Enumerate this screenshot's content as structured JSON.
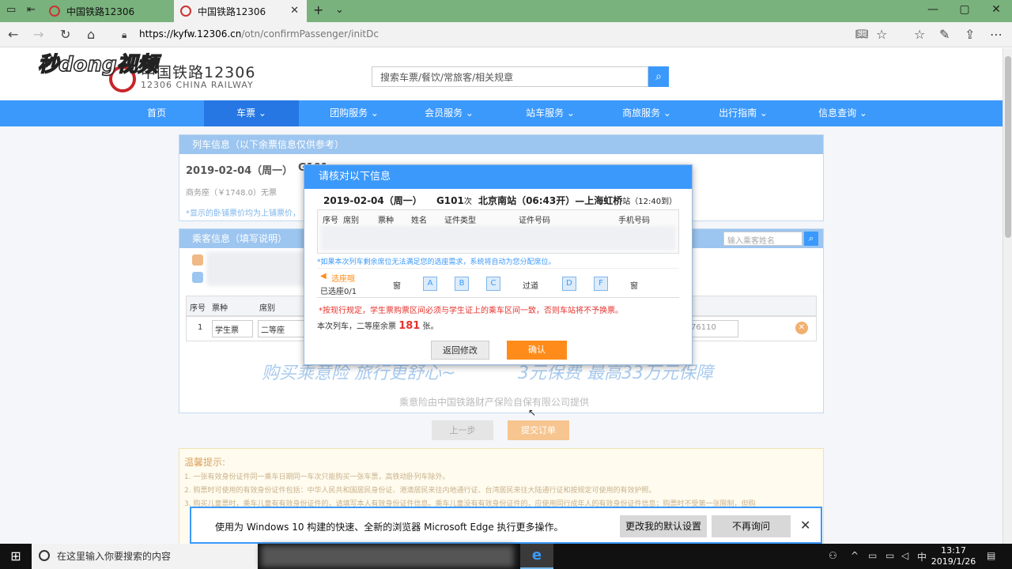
{
  "browser": {
    "tabs": [
      {
        "label": "中国铁路12306"
      },
      {
        "label": "中国铁路12306"
      }
    ],
    "url_host": "https://kyfw.12306.cn",
    "url_path": "/otn/confirmPassenger/initDc",
    "watermark": "秒dong视频"
  },
  "site": {
    "logo_cn": "中国铁路12306",
    "logo_en": "12306 CHINA RAILWAY",
    "search_placeholder": "搜索车票/餐饮/常旅客/相关规章",
    "nav": [
      "首页",
      "车票 ⌄",
      "团购服务 ⌄",
      "会员服务 ⌄",
      "站车服务 ⌄",
      "商旅服务 ⌄",
      "出行指南 ⌄",
      "信息查询 ⌄"
    ]
  },
  "train_panel": {
    "title": "列车信息（以下余票信息仅供参考）",
    "date": "2019-02-04（周一）",
    "train_no": "G101",
    "seat_price": "商务座（￥1748.0）无票",
    "note": "*显示的卧铺票价均为上铺票价，"
  },
  "passenger_panel": {
    "title": "乘客信息（填写说明）",
    "search_placeholder": "输入乘客姓名",
    "headers": [
      "序号",
      "票种",
      "席别"
    ],
    "row": {
      "index": "1",
      "ticket_type": "学生票",
      "seat": "二等座（￥5",
      "phone_tail": "76110"
    }
  },
  "insurance": {
    "slogan_prefix": "购买乘意险  旅行更舒心~",
    "slogan_price": "3元保费  最高33万元保障",
    "provider": "乘意险由中国铁路财产保险自保有限公司提供"
  },
  "page_actions": {
    "prev": "上一步",
    "submit": "提交订单"
  },
  "tips": {
    "title": "温馨提示:",
    "items": [
      "1. 一张有效身份证件同一乘车日期同一车次只能购买一张车票，高铁动卧列车除外。",
      "2. 购票时可使用的有效身份证件包括：中华人民共和国居民身份证、港澳居民来往内地通行证、台湾居民来往大陆通行证和按规定可使用的有效护照。",
      "3. 购买儿童票时，乘车儿童有有效身份证件的，请填写本人有效身份证件信息。乘车儿童没有有效身份证件的，应使用同行成年人的有效身份证件信息；购票时不受第一张限制，但购"
    ]
  },
  "modal": {
    "title": "请核对以下信息",
    "date": "2019-02-04（周一）",
    "train": "G101",
    "train_suffix": "次",
    "route": "北京南",
    "route_suffix": "站（06:43开）—上海虹桥",
    "arrive": "站（12:40到）",
    "table_headers": [
      "序号",
      "席别",
      "票种",
      "姓名",
      "证件类型",
      "证件号码",
      "手机号码"
    ],
    "seat_tip": "*如果本次列车剩余席位无法满足您的选座需求，系统将自动为您分配席位。",
    "seat_select_label": "选座哦",
    "seat_selected": "已选座0/1",
    "seat_layout": [
      "窗",
      "A",
      "B",
      "C",
      "过道",
      "D",
      "F",
      "窗"
    ],
    "rule": "*按现行规定，学生票购票区间必须与学生证上的乘车区间一致，否则车站将不予换票。",
    "remain_prefix": "本次列车，二等座余票",
    "remain_count": "181",
    "remain_suffix": "张。",
    "back_btn": "返回修改",
    "confirm_btn": "确认"
  },
  "edge_notice": {
    "text": "使用为 Windows 10 构建的快速、全新的浏览器 Microsoft Edge 执行更多操作。",
    "btn_default": "更改我的默认设置",
    "btn_never": "不再询问"
  },
  "taskbar": {
    "search_placeholder": "在这里输入你要搜索的内容",
    "ime": "中",
    "time": "13:17",
    "date": "2019/1/26"
  },
  "colors": {
    "accent": "#3b99fc",
    "confirm": "#ff8c1a",
    "alert": "#e5322d"
  }
}
